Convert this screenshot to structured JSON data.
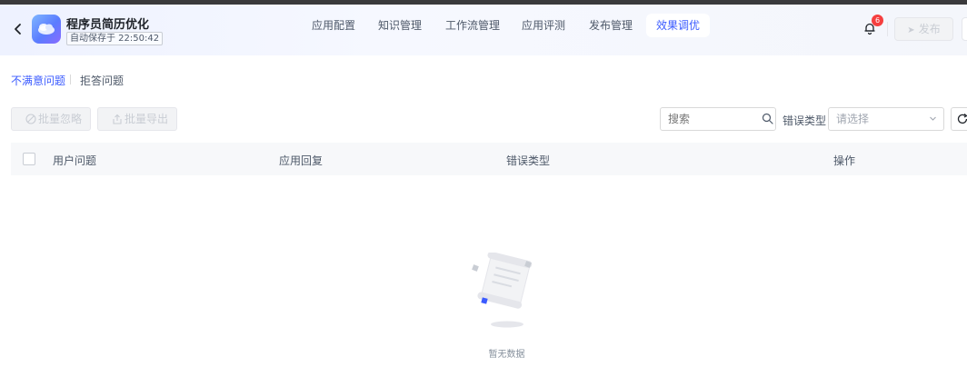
{
  "app": {
    "title": "程序员简历优化",
    "autosave": "自动保存于 22:50:42"
  },
  "nav": {
    "tabs": [
      {
        "label": "应用配置",
        "active": false
      },
      {
        "label": "知识管理",
        "active": false
      },
      {
        "label": "工作流管理",
        "active": false
      },
      {
        "label": "应用评测",
        "active": false
      },
      {
        "label": "发布管理",
        "active": false
      },
      {
        "label": "效果调优",
        "active": true
      }
    ]
  },
  "header": {
    "notification_count": "6",
    "publish_label": "发布"
  },
  "subtabs": [
    {
      "label": "不满意问题",
      "active": true
    },
    {
      "label": "拒答问题",
      "active": false
    }
  ],
  "toolbar": {
    "batch_ignore_label": "批量忽略",
    "batch_export_label": "批量导出",
    "search_placeholder": "搜索",
    "error_type_label": "错误类型",
    "error_type_placeholder": "请选择"
  },
  "table": {
    "columns": [
      "用户问题",
      "应用回复",
      "错误类型",
      "操作"
    ],
    "rows": []
  },
  "empty_state": {
    "text": "暂无数据"
  },
  "colors": {
    "accent": "#3b5bff",
    "badge": "#f53f3f",
    "header_bg": "#eef2ff"
  }
}
